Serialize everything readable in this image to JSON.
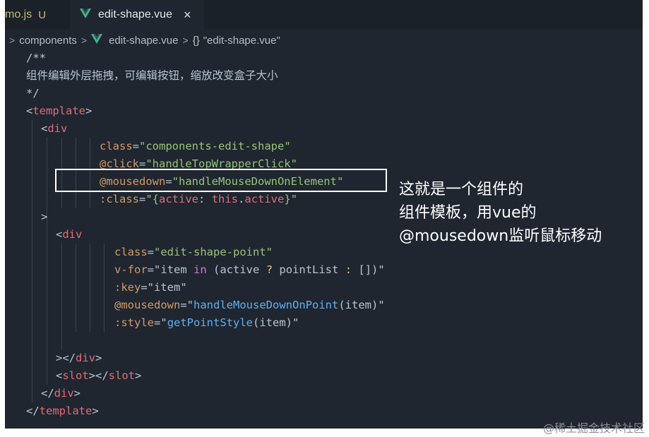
{
  "tabs": [
    {
      "label": "mo.js",
      "status": "U"
    },
    {
      "label": "edit-shape.vue",
      "close": "×"
    }
  ],
  "breadcrumb": {
    "folder": "components",
    "file": "edit-shape.vue",
    "symbol": "\"edit-shape.vue\""
  },
  "code": {
    "comment_open": "/**",
    "comment_text": "组件编辑外层拖拽，可编辑按钮，缩放改变盒子大小",
    "comment_close": "*/",
    "template_tag": "template",
    "div_tag": "div",
    "slot_tag": "slot",
    "attr_class": "class",
    "val_class": "\"components-edit-shape\"",
    "attr_click": "@click",
    "val_click": "\"handleTopWrapperClick\"",
    "attr_mousedown": "@mousedown",
    "val_mousedown": "\"handleMouseDownOnElement\"",
    "attr_bind_class": ":class",
    "val_bind_class_open": "\"{",
    "val_bind_class_active": "active",
    "val_bind_class_colon": ": ",
    "val_bind_class_this": "this",
    "val_bind_class_dot": ".",
    "val_bind_class_prop": "active",
    "val_bind_class_close": "}\"",
    "attr_inner_class": "class",
    "val_inner_class": "\"edit-shape-point\"",
    "attr_vfor": "v-for",
    "val_vfor_a": "\"item ",
    "val_vfor_in": "in",
    "val_vfor_b": " (active ",
    "val_vfor_q": "?",
    "val_vfor_c": " pointList ",
    "val_vfor_colon": ":",
    "val_vfor_d": " [])\"",
    "attr_key": ":key",
    "val_key": "\"item\"",
    "attr_mousedown2": "@mousedown",
    "val_mousedown2_q": "\"",
    "val_mousedown2_fn": "handleMouseDownOnPoint",
    "val_mousedown2_rest": "(item)\"",
    "attr_style": ":style",
    "val_style_q": "\"",
    "val_style_fn": "getPointStyle",
    "val_style_rest": "(item)\""
  },
  "annotation": {
    "line1": "这就是一个组件的",
    "line2": "组件模板，用vue的",
    "line3": "@mousedown监听鼠标移动"
  },
  "watermark": "@稀土掘金技术社区",
  "colors": {
    "editor_bg": "#1f2630",
    "tag": "#e06c75",
    "attr": "#d19a66",
    "string": "#98c379",
    "function": "#61afef",
    "vue_icon": "#41b883"
  }
}
